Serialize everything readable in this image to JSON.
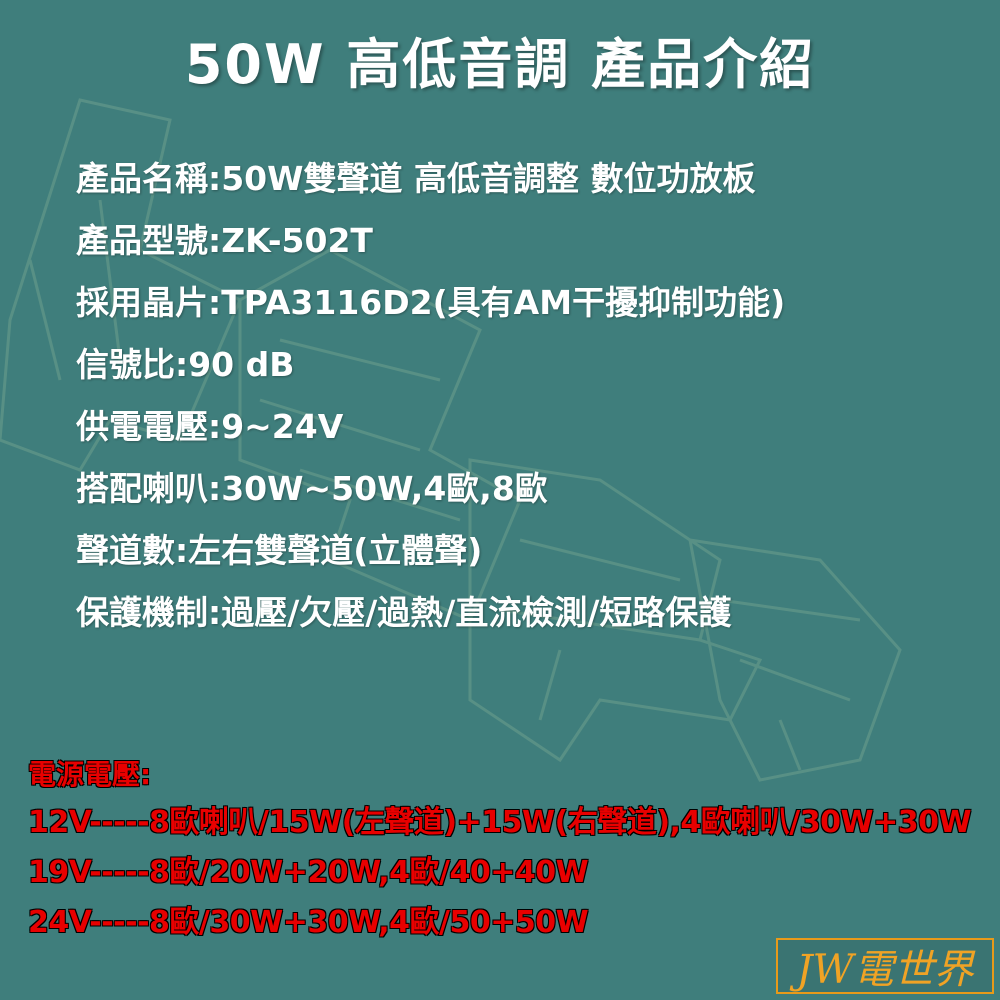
{
  "title": "50W 高低音調 產品介紹",
  "specs": [
    "產品名稱:50W雙聲道 高低音調整 數位功放板",
    "產品型號:ZK-502T",
    "採用晶片:TPA3116D2(具有AM干擾抑制功能)",
    "信號比:90 dB",
    "供電電壓:9~24V",
    "搭配喇叭:30W~50W,4歐,8歐",
    "聲道數:左右雙聲道(立體聲)",
    "保護機制:過壓/欠壓/過熱/直流檢測/短路保護"
  ],
  "power": {
    "heading": "電源電壓:",
    "rows": [
      "12V-----8歐喇叭/15W(左聲道)+15W(右聲道),4歐喇叭/30W+30W",
      "19V-----8歐/20W+20W,4歐/40+40W",
      "24V-----8歐/30W+30W,4歐/50+50W"
    ]
  },
  "logo": "JW電世界",
  "colors": {
    "background": "#3f7e7c",
    "text": "#ffffff",
    "power_text": "#e80000",
    "logo": "#f0a325"
  }
}
